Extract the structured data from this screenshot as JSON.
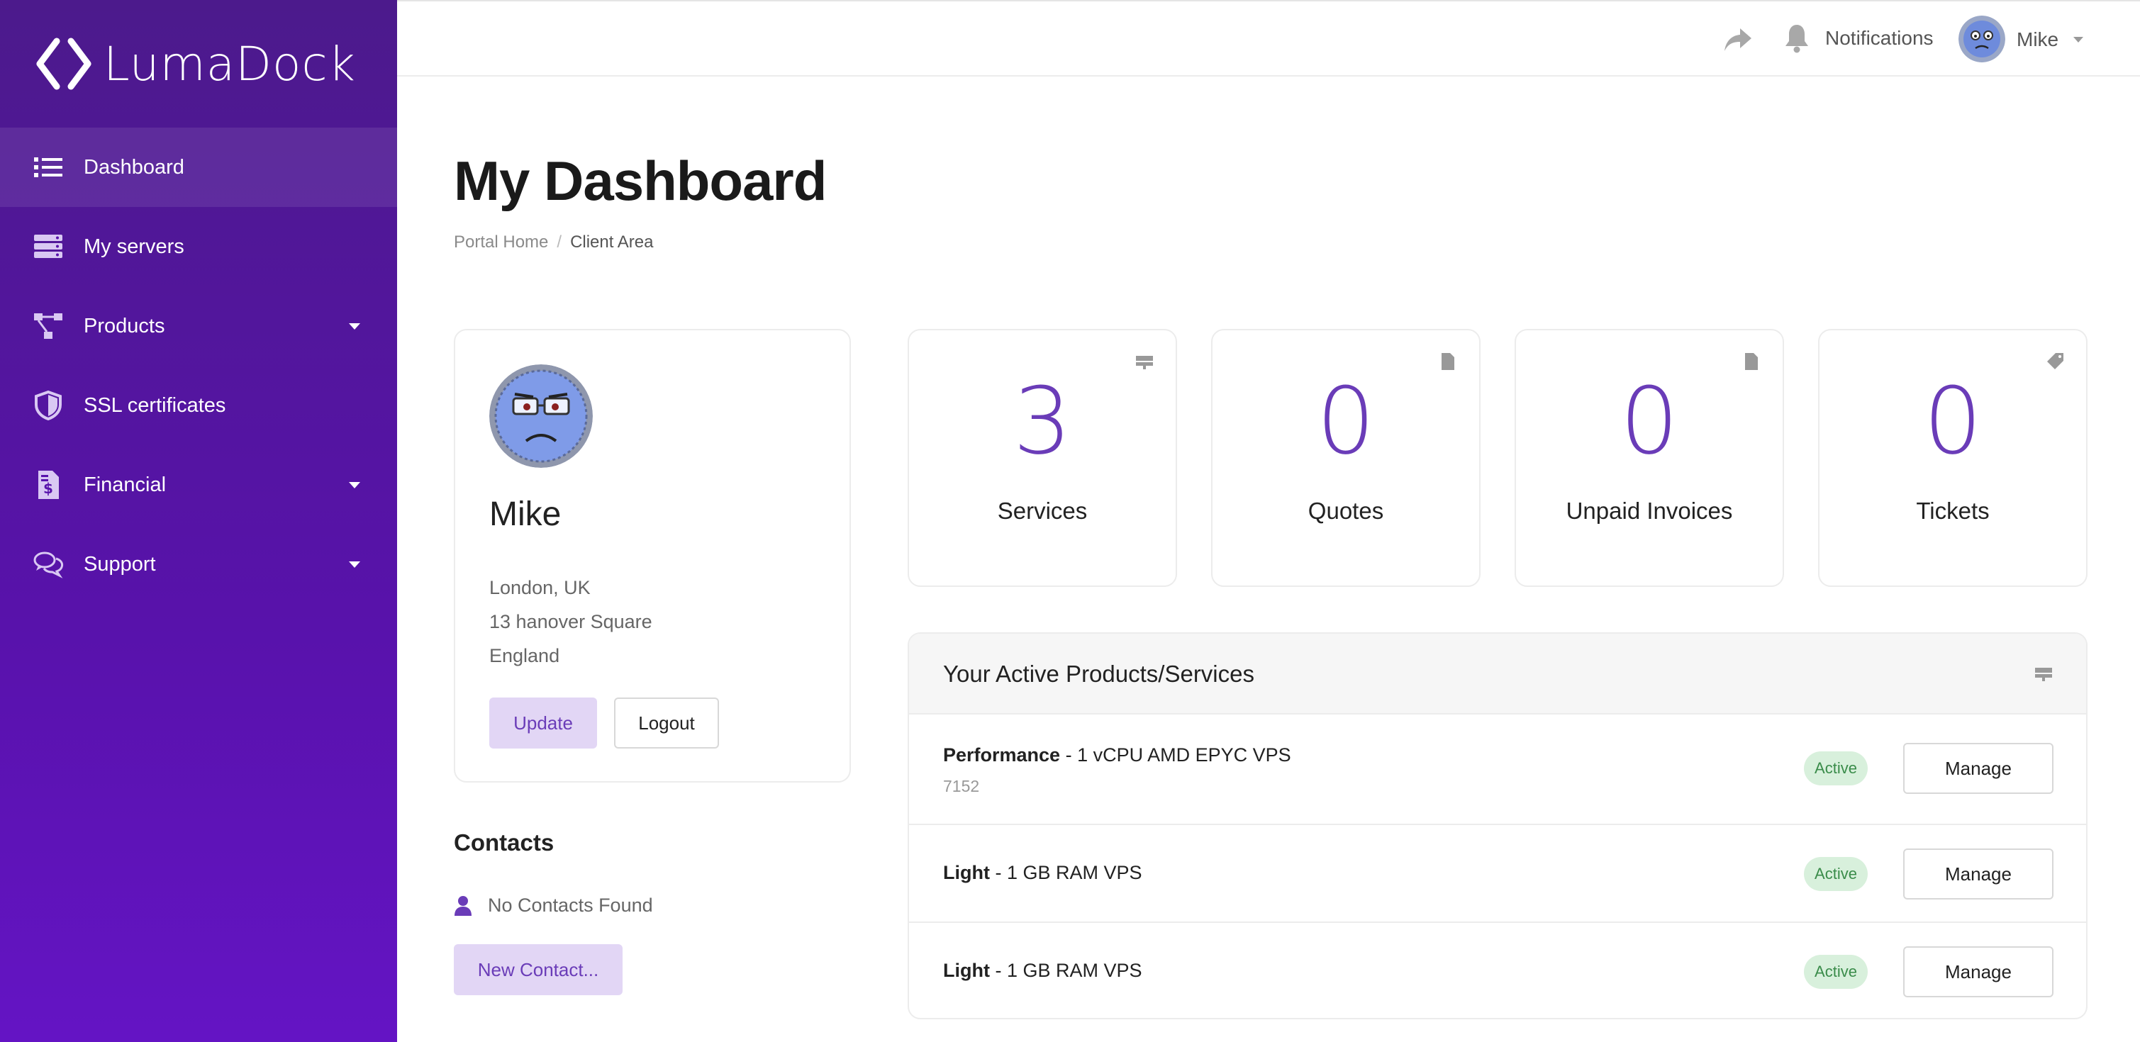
{
  "brand": {
    "name": "LumaDock"
  },
  "sidebar": {
    "items": [
      {
        "label": "Dashboard",
        "icon": "list-icon"
      },
      {
        "label": "My servers",
        "icon": "server-icon"
      },
      {
        "label": "Products",
        "icon": "hierarchy-icon"
      },
      {
        "label": "SSL certificates",
        "icon": "shield-icon"
      },
      {
        "label": "Financial",
        "icon": "invoice-icon"
      },
      {
        "label": "Support",
        "icon": "comments-icon"
      }
    ]
  },
  "header": {
    "notifications_label": "Notifications",
    "user_name": "Mike"
  },
  "page": {
    "title": "My Dashboard",
    "breadcrumb": {
      "home": "Portal Home",
      "separator": "/",
      "current": "Client Area"
    }
  },
  "profile": {
    "name": "Mike",
    "address": [
      "London, UK",
      "13 hanover Square",
      "England"
    ],
    "update_label": "Update",
    "logout_label": "Logout"
  },
  "contacts": {
    "title": "Contacts",
    "empty_text": "No Contacts Found",
    "new_label": "New Contact..."
  },
  "stats": [
    {
      "value": "3",
      "label": "Services",
      "icon": "server-small-icon"
    },
    {
      "value": "0",
      "label": "Quotes",
      "icon": "file-icon"
    },
    {
      "value": "0",
      "label": "Unpaid Invoices",
      "icon": "file-icon"
    },
    {
      "value": "0",
      "label": "Tickets",
      "icon": "tag-icon"
    }
  ],
  "services": {
    "title": "Your Active Products/Services",
    "items": [
      {
        "product": "Performance",
        "sep": " - ",
        "plan": "1 vCPU AMD EPYC VPS",
        "sub": "7152",
        "status": "Active",
        "action": "Manage"
      },
      {
        "product": "Light",
        "sep": " - ",
        "plan": "1 GB RAM VPS",
        "sub": "",
        "status": "Active",
        "action": "Manage"
      },
      {
        "product": "Light",
        "sep": " - ",
        "plan": "1 GB RAM VPS",
        "sub": "",
        "status": "Active",
        "action": "Manage"
      }
    ]
  },
  "colors": {
    "sidebar": "#5812ab",
    "accent": "#6a3cb8",
    "badge_bg": "#d8f0dc",
    "badge_text": "#3a8c4a"
  }
}
